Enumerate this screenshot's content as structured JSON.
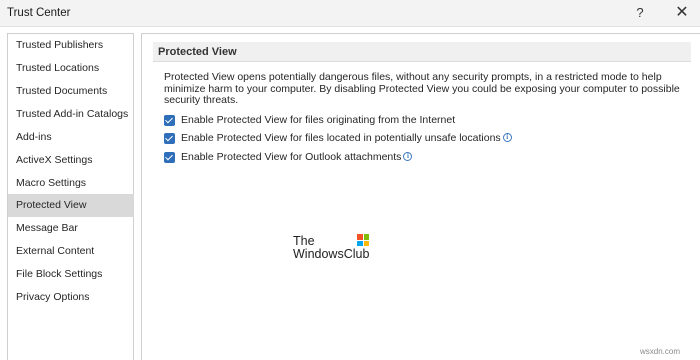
{
  "window": {
    "title": "Trust Center",
    "help_glyph": "?",
    "close_glyph": "✕"
  },
  "sidebar": {
    "items": [
      {
        "label": "Trusted Publishers",
        "selected": false
      },
      {
        "label": "Trusted Locations",
        "selected": false
      },
      {
        "label": "Trusted Documents",
        "selected": false
      },
      {
        "label": "Trusted Add-in Catalogs",
        "selected": false
      },
      {
        "label": "Add-ins",
        "selected": false
      },
      {
        "label": "ActiveX Settings",
        "selected": false
      },
      {
        "label": "Macro Settings",
        "selected": false
      },
      {
        "label": "Protected View",
        "selected": true
      },
      {
        "label": "Message Bar",
        "selected": false
      },
      {
        "label": "External Content",
        "selected": false
      },
      {
        "label": "File Block Settings",
        "selected": false
      },
      {
        "label": "Privacy Options",
        "selected": false
      }
    ]
  },
  "main": {
    "section_title": "Protected View",
    "description": "Protected View opens potentially dangerous files, without any security prompts, in a restricted mode to help minimize harm to your computer. By disabling Protected View you could be exposing your computer to possible security threats.",
    "options": [
      {
        "label": "Enable Protected View for files originating from the Internet",
        "checked": true,
        "info_icon": false
      },
      {
        "label": "Enable Protected View for files located in potentially unsafe locations",
        "checked": true,
        "info_icon": true
      },
      {
        "label": "Enable Protected View for Outlook attachments",
        "checked": true,
        "info_icon": true
      }
    ]
  },
  "watermark": {
    "line1": "The",
    "line2": "WindowsClub",
    "site": "wsxdn.com"
  },
  "colors": {
    "checkbox": "#2f6eb8",
    "selected_nav": "#d9d9d9",
    "logo": [
      "#f35325",
      "#81bc06",
      "#05a6f0",
      "#ffba08"
    ]
  }
}
